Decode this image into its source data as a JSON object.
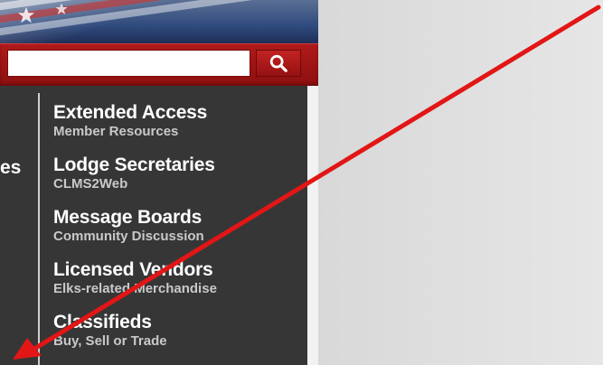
{
  "search": {
    "value": "",
    "placeholder": "",
    "button_icon": "search-icon"
  },
  "left_column": {
    "fragment_text": "es"
  },
  "menu": {
    "items": [
      {
        "title": "Extended Access",
        "subtitle": "Member Resources"
      },
      {
        "title": "Lodge Secretaries",
        "subtitle": "CLMS2Web"
      },
      {
        "title": "Message Boards",
        "subtitle": "Community Discussion"
      },
      {
        "title": "Licensed Vendors",
        "subtitle": "Elks-related Merchandise"
      },
      {
        "title": "Classifieds",
        "subtitle": "Buy, Sell or Trade"
      }
    ]
  },
  "annotation": {
    "arrow_color": "#e21616"
  },
  "colors": {
    "header_red": "#a81515",
    "menu_bg": "#363636",
    "subtitle_gray": "#c9c9c9"
  }
}
